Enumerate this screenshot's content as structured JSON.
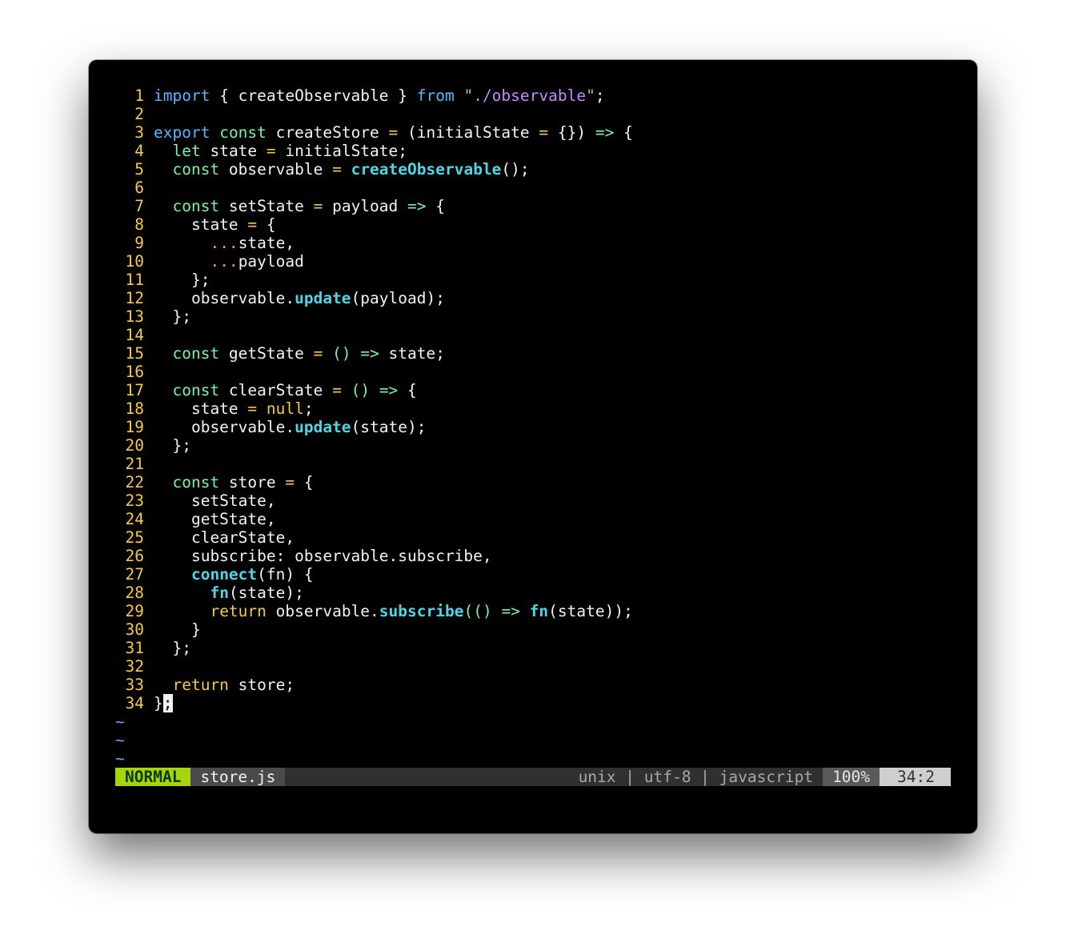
{
  "editor": {
    "lines": [
      {
        "n": "1",
        "html": "<span class=\"kw-import\">import</span> { createObservable } <span class=\"kw-import\">from</span> <span class=\"str-q\">\"</span><span class=\"str\">./observable</span><span class=\"str-q\">\"</span>;"
      },
      {
        "n": "2",
        "html": ""
      },
      {
        "n": "3",
        "html": "<span class=\"kw-import\">export</span> <span class=\"kw-const\">const</span> createStore <span class=\"op\">=</span> (initialState <span class=\"op\">=</span> {}) <span class=\"arrow\">=&gt;</span> {"
      },
      {
        "n": "4",
        "html": "  <span class=\"kw-const\">let</span> state <span class=\"op\">=</span> initialState;"
      },
      {
        "n": "5",
        "html": "  <span class=\"kw-const\">const</span> observable <span class=\"op\">=</span> <span class=\"fn\">createObservable</span>();"
      },
      {
        "n": "6",
        "html": ""
      },
      {
        "n": "7",
        "html": "  <span class=\"kw-const\">const</span> setState <span class=\"op\">=</span> payload <span class=\"arrow\">=&gt;</span> {"
      },
      {
        "n": "8",
        "html": "    state <span class=\"op\">=</span> {"
      },
      {
        "n": "9",
        "html": "      <span class=\"spread\">...</span>state,"
      },
      {
        "n": "10",
        "html": "      <span class=\"spread\">...</span>payload"
      },
      {
        "n": "11",
        "html": "    };"
      },
      {
        "n": "12",
        "html": "    observable.<span class=\"fn\">update</span>(payload);"
      },
      {
        "n": "13",
        "html": "  };"
      },
      {
        "n": "14",
        "html": ""
      },
      {
        "n": "15",
        "html": "  <span class=\"kw-const\">const</span> getState <span class=\"op\">=</span> <span class=\"paren-g\">()</span> <span class=\"arrow\">=&gt;</span> state;"
      },
      {
        "n": "16",
        "html": ""
      },
      {
        "n": "17",
        "html": "  <span class=\"kw-const\">const</span> clearState <span class=\"op\">=</span> <span class=\"paren-g\">()</span> <span class=\"arrow\">=&gt;</span> {"
      },
      {
        "n": "18",
        "html": "    state <span class=\"op\">=</span> <span class=\"kw-null\">null</span>;"
      },
      {
        "n": "19",
        "html": "    observable.<span class=\"fn\">update</span>(state);"
      },
      {
        "n": "20",
        "html": "  };"
      },
      {
        "n": "21",
        "html": ""
      },
      {
        "n": "22",
        "html": "  <span class=\"kw-const\">const</span> store <span class=\"op\">=</span> {"
      },
      {
        "n": "23",
        "html": "    setState,"
      },
      {
        "n": "24",
        "html": "    getState,"
      },
      {
        "n": "25",
        "html": "    clearState,"
      },
      {
        "n": "26",
        "html": "    subscribe: observable.subscribe,"
      },
      {
        "n": "27",
        "html": "    <span class=\"fn\">connect</span>(fn) {"
      },
      {
        "n": "28",
        "html": "      <span class=\"fn\">fn</span>(state);"
      },
      {
        "n": "29",
        "html": "      <span class=\"kw-return\">return</span> observable.<span class=\"fn\">subscribe</span><span class=\"paren-g\">(</span><span class=\"paren-g\">()</span> <span class=\"arrow\">=&gt;</span> <span class=\"fn\">fn</span>(state));"
      },
      {
        "n": "30",
        "html": "    }"
      },
      {
        "n": "31",
        "html": "  };"
      },
      {
        "n": "32",
        "html": ""
      },
      {
        "n": "33",
        "html": "  <span class=\"kw-return\">return</span> store;"
      },
      {
        "n": "34",
        "html": "}<span class=\"cursor\">;</span>"
      }
    ],
    "tildes": [
      "~",
      "~",
      "~"
    ]
  },
  "statusbar": {
    "mode": "NORMAL",
    "filename": "store.js",
    "fileinfo": "unix | utf-8 | javascript",
    "percent": "100%",
    "position": "34:2"
  },
  "colors": {
    "background": "#000000",
    "line_number": "#f7c948",
    "mode_bg": "#a6d609",
    "tilde": "#6aa7f7"
  }
}
